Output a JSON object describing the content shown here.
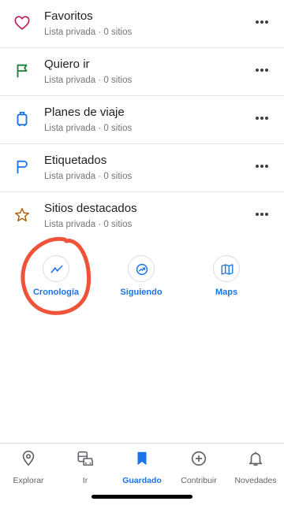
{
  "lists": [
    {
      "title": "Favoritos",
      "subtitle": "Lista privada · 0 sitios",
      "icon": "heart-icon",
      "color": "#c2185b"
    },
    {
      "title": "Quiero ir",
      "subtitle": "Lista privada · 0 sitios",
      "icon": "flag-icon",
      "color": "#188038"
    },
    {
      "title": "Planes de viaje",
      "subtitle": "Lista privada · 0 sitios",
      "icon": "suitcase-icon",
      "color": "#1a73e8"
    },
    {
      "title": "Etiquetados",
      "subtitle": "Lista privada · 0 sitios",
      "icon": "label-flag-icon",
      "color": "#1a73e8"
    },
    {
      "title": "Sitios destacados",
      "subtitle": "Lista privada · 0 sitios",
      "icon": "star-icon",
      "color": "#b06000"
    }
  ],
  "shortcuts": [
    {
      "label": "Cronología",
      "icon": "timeline-icon"
    },
    {
      "label": "Siguiendo",
      "icon": "following-icon"
    },
    {
      "label": "Maps",
      "icon": "map-icon"
    }
  ],
  "bottom_nav": [
    {
      "label": "Explorar",
      "icon": "location-pin-icon",
      "active": false
    },
    {
      "label": "Ir",
      "icon": "commute-icon",
      "active": false
    },
    {
      "label": "Guardado",
      "icon": "bookmark-icon",
      "active": true
    },
    {
      "label": "Contribuir",
      "icon": "add-circle-icon",
      "active": false
    },
    {
      "label": "Novedades",
      "icon": "bell-icon",
      "active": false
    }
  ],
  "colors": {
    "accent": "#1a73e8",
    "annotation": "#f0533a"
  }
}
